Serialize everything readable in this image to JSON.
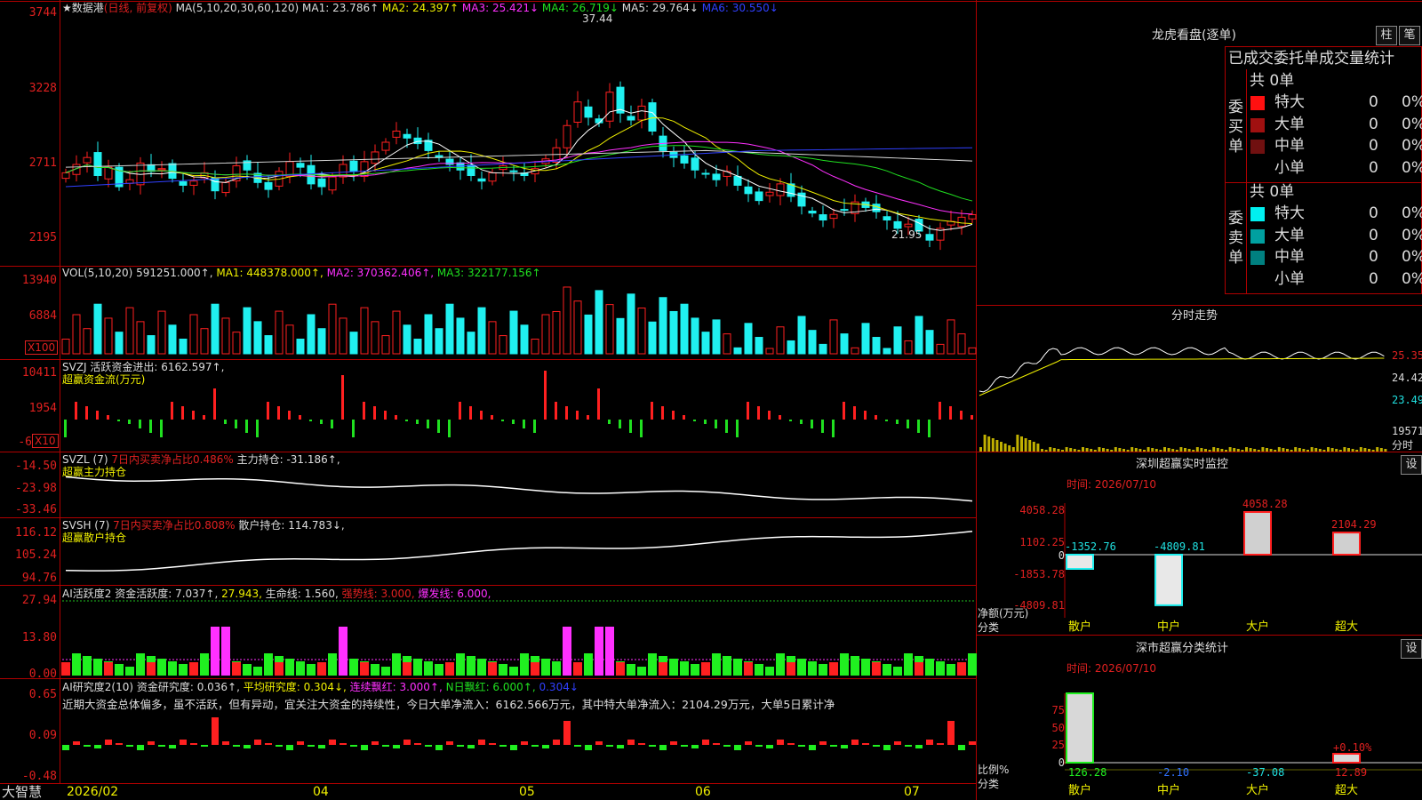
{
  "main": {
    "title": "★数据港",
    "mode": "(日线, 前复权)",
    "ma_spec": "MA(5,10,20,30,60,120)",
    "ma1": "MA1: 23.786↑",
    "ma2": "MA2: 24.397↑",
    "ma3": "MA3: 25.421↓",
    "ma4": "MA4: 26.719↓",
    "ma5": "MA5: 29.764↓",
    "ma6": "MA6: 30.550↓",
    "ticks": [
      "3744",
      "3228",
      "2711",
      "2195"
    ],
    "high_label": "37.44",
    "low_label": "21.95"
  },
  "vol": {
    "head": "VOL(5,10,20) 591251.000↑,",
    "ma1": "MA1: 448378.000↑,",
    "ma2": "MA2: 370362.406↑,",
    "ma3": "MA3: 322177.156↑",
    "ticks": [
      "13940",
      "6884"
    ],
    "unit": "X100"
  },
  "svzj": {
    "head": "SVZJ  活跃资金进出: 6162.597↑,",
    "sub": "超赢资金流(万元)",
    "ticks": [
      "10411",
      "1954",
      "-6"
    ],
    "unit": "X10"
  },
  "svzl": {
    "head": "SVZL (7)",
    "ratio": "7日内买卖净占比0.486%",
    "hold": "主力持仓: -31.186↑,",
    "sub": "超赢主力持仓",
    "ticks": [
      "-14.50",
      "-23.98",
      "-33.46"
    ]
  },
  "svsh": {
    "head": "SVSH (7)",
    "ratio": "7日内买卖净占比0.808%",
    "hold": "散户持仓: 114.783↓,",
    "sub": "超赢散户持仓",
    "ticks": [
      "116.12",
      "105.24",
      "94.76"
    ]
  },
  "ai": {
    "head": "AI活跃度2 资金活跃度: 7.037↑,",
    "v2": "27.943,",
    "life": "生命线: 1.560,",
    "strong": "强势线: 3.000,",
    "burst": "爆发线: 6.000,",
    "ticks": [
      "27.94",
      "13.80",
      "0.00"
    ]
  },
  "research": {
    "head": "AI研究度2(10) 资金研究度: 0.036↑,",
    "avg": "平均研究度: 0.304↓,",
    "cont": "连续飘红: 3.000↑,",
    "nday": "N日飘红: 6.000↑,",
    "last": "0.304↓",
    "comment": "近期大资金总体偏多，虽不活跃，但有异动，宜关注大资金的持续性，今日大单净流入：6162.566万元，其中特大单净流入：2104.29万元，大单5日累计净",
    "ticks": [
      "0.65",
      "0.09",
      "-0.48"
    ]
  },
  "bottom": {
    "brand": "大智慧",
    "months": [
      "2026/02",
      "04",
      "05",
      "06",
      "07"
    ]
  },
  "dragon": {
    "title": "龙虎看盘(逐单)",
    "btn_col": "柱",
    "btn_pen": "笔",
    "header": "已成交委托单成交量统计",
    "buy": {
      "label": "委买单",
      "total": "共 0单",
      "rows": [
        {
          "name": "特大",
          "v": "0",
          "p": "0%",
          "c": "#ff1010"
        },
        {
          "name": "大单",
          "v": "0",
          "p": "0%",
          "c": "#a01010"
        },
        {
          "name": "中单",
          "v": "0",
          "p": "0%",
          "c": "#701010"
        },
        {
          "name": "小单",
          "v": "0",
          "p": "0%",
          "c": "#000"
        }
      ]
    },
    "sell": {
      "label": "委卖单",
      "total": "共 0单",
      "rows": [
        {
          "name": "特大",
          "v": "0",
          "p": "0%",
          "c": "#00f0f0"
        },
        {
          "name": "大单",
          "v": "0",
          "p": "0%",
          "c": "#00a0a0"
        },
        {
          "name": "中单",
          "v": "0",
          "p": "0%",
          "c": "#008080"
        },
        {
          "name": "小单",
          "v": "0",
          "p": "0%",
          "c": "#000"
        }
      ]
    }
  },
  "intraday": {
    "title": "分时走势",
    "ticks": [
      "25.35",
      "24.42",
      "23.49"
    ],
    "vol_tick": "19571",
    "vol_unit": "分时"
  },
  "szmon": {
    "title": "深圳超赢实时监控",
    "btn": "设",
    "time": "时间: 2026/07/10",
    "ticks": [
      "4058.28",
      "1102.25",
      "0",
      "-1853.78",
      "-4809.81"
    ],
    "unit_label": "净额(万元)",
    "cat_label": "分类",
    "values": [
      -1352.76,
      -4809.81,
      4058.28,
      2104.29
    ],
    "value_labels": [
      "-1352.76",
      "-4809.81",
      "4058.28",
      "2104.29"
    ],
    "cats": [
      "散户",
      "中户",
      "大户",
      "超大"
    ]
  },
  "szclass": {
    "title": "深市超赢分类统计",
    "btn": "设",
    "time": "时间: 2026/07/10",
    "ticks": [
      "75",
      "50",
      "25",
      "0"
    ],
    "unit_label": "比例%",
    "cat_label": "分类",
    "value_labels": [
      "126.28",
      "-2.10",
      "-37.08",
      "12.89"
    ],
    "pct_label": "+0.10%",
    "cats": [
      "散户",
      "中户",
      "大户",
      "超大"
    ]
  },
  "chart_data": {
    "type": "candlestick",
    "title": "数据港 (日线, 前复权)",
    "x_range": [
      "2026/02",
      "2026/07"
    ],
    "ylim": [
      21.95,
      37.44
    ],
    "close_series": [
      26.8,
      27.4,
      27.9,
      26.6,
      27.2,
      25.8,
      26.3,
      27.5,
      26.9,
      27.1,
      26.4,
      25.9,
      26.2,
      26.8,
      25.5,
      26.1,
      27.3,
      27.0,
      26.1,
      25.6,
      26.9,
      27.6,
      27.2,
      26.0,
      25.8,
      26.5,
      27.4,
      26.9,
      27.6,
      28.3,
      29.0,
      29.8,
      29.3,
      28.9,
      28.4,
      27.9,
      27.4,
      27.0,
      26.6,
      26.2,
      26.8,
      27.3,
      26.9,
      26.6,
      27.1,
      27.8,
      28.6,
      30.2,
      31.9,
      30.8,
      30.4,
      32.6,
      31.1,
      30.6,
      31.6,
      29.8,
      28.4,
      27.9,
      27.5,
      27.0,
      26.7,
      26.3,
      26.9,
      25.9,
      25.3,
      24.8,
      25.4,
      26.0,
      25.1,
      24.4,
      23.9,
      23.4,
      23.8,
      24.1,
      24.7,
      24.3,
      24.0,
      23.4,
      22.8,
      23.1,
      22.6,
      21.95,
      22.8,
      23.3,
      23.6,
      23.786
    ]
  }
}
